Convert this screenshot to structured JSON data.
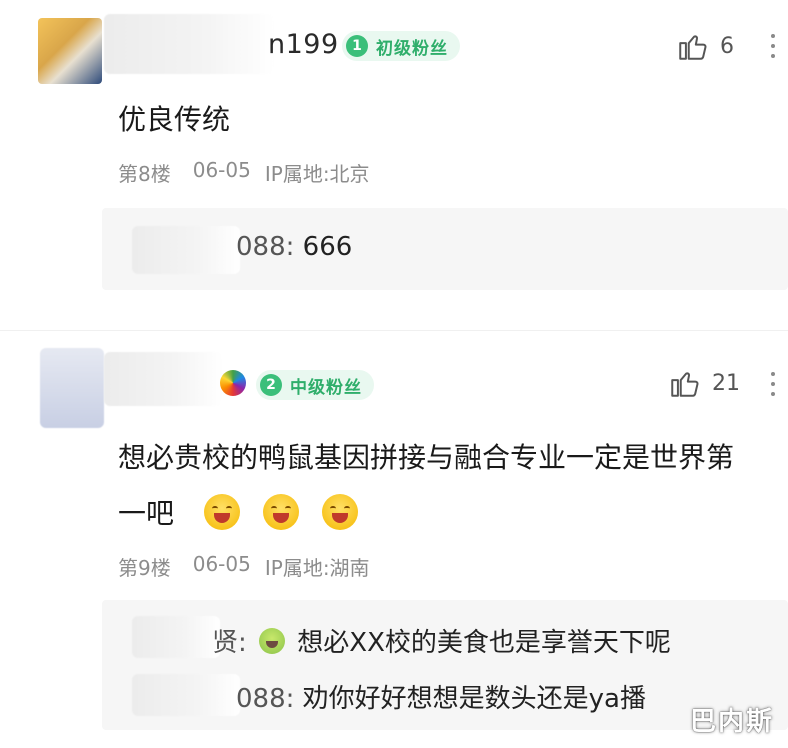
{
  "comments": [
    {
      "username": "n199",
      "badge_level": "1",
      "badge_label": "初级粉丝",
      "like_count": "6",
      "content": "优良传统",
      "floor": "第8楼",
      "date": "06-05",
      "ip": "IP属地:北京",
      "replies": [
        {
          "name": "088:",
          "text": "666"
        }
      ]
    },
    {
      "username": "",
      "username_suffix_icon": "rainbow-icon",
      "badge_level": "2",
      "badge_label": "中级粉丝",
      "like_count": "21",
      "content_line1": "想必贵校的鸭鼠基因拼接与融合专业一定是世界第",
      "content_line2": "一吧",
      "content_emojis": [
        "laughing-face-icon",
        "laughing-face-icon",
        "laughing-face-icon"
      ],
      "floor": "第9楼",
      "date": "06-05",
      "ip": "IP属地:湖南",
      "replies": [
        {
          "name": "贤:",
          "text": "想必XX校的美食也是享誉天下呢",
          "emoji": "sick-face-icon"
        },
        {
          "name": "088:",
          "text": "劝你好好想想是数头还是ya播"
        }
      ]
    }
  ],
  "watermark": "巴内斯",
  "colors": {
    "badge_green": "#3bbf7a",
    "badge_bg": "#e9f8f0",
    "meta_gray": "#8c8c8c",
    "reply_bg": "#f6f6f6"
  }
}
